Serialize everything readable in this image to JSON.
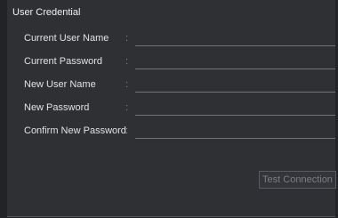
{
  "section": {
    "title": "User Credential"
  },
  "colon": ":",
  "fields": [
    {
      "label": "Current User Name",
      "value": ""
    },
    {
      "label": "Current Password",
      "value": ""
    },
    {
      "label": "New User Name",
      "value": ""
    },
    {
      "label": "New Password",
      "value": ""
    },
    {
      "label": "Confirm New Password",
      "value": ""
    }
  ],
  "buttons": {
    "test_connection": "Test Connection"
  },
  "colors": {
    "background": "#2f3034",
    "field_underline": "#3b7fc4",
    "disabled_text": "#7c7d82"
  }
}
